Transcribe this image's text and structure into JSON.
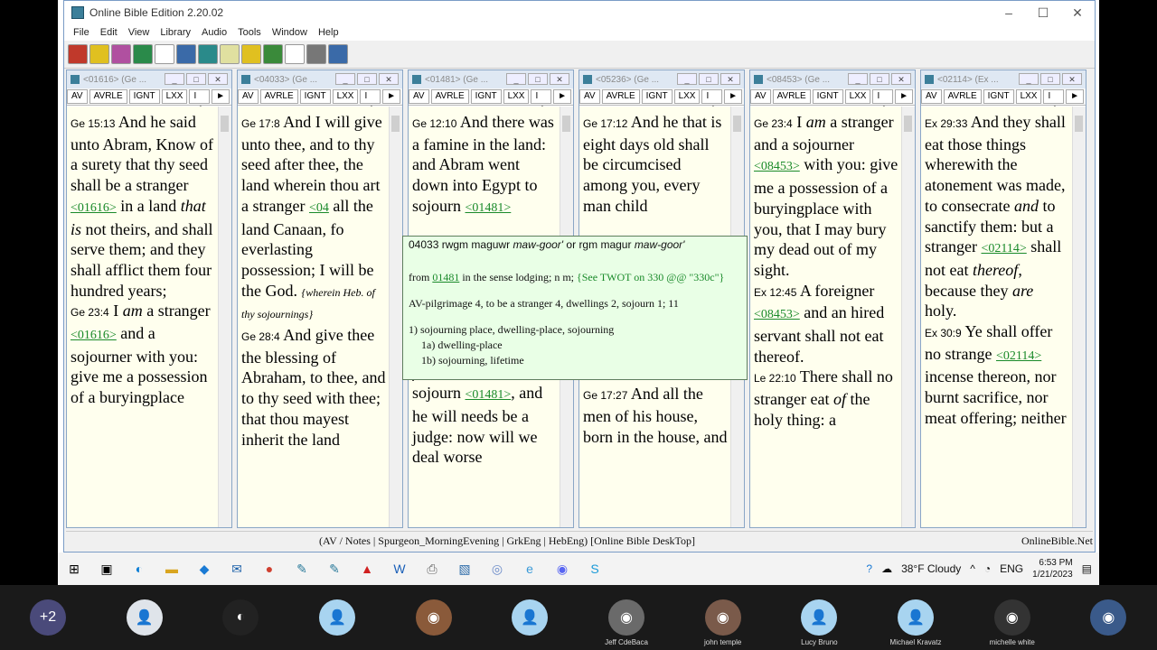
{
  "window": {
    "title": "Online Bible Edition 2.20.02",
    "min": "–",
    "max": "☐",
    "close": "✕"
  },
  "menu": [
    "File",
    "Edit",
    "View",
    "Library",
    "Audio",
    "Tools",
    "Window",
    "Help"
  ],
  "toolbar_icons": [
    "book-red-icon",
    "book-yellow-icon",
    "books-icon",
    "globe-icon",
    "open-book-icon",
    "tools-icon",
    "edit-icon",
    "notes-icon",
    "folder-icon",
    "check-icon",
    "document-icon",
    "printer-icon",
    "search-icon"
  ],
  "pane_tabs": [
    "AV",
    "AVRLE",
    "IGNT",
    "LXX",
    "I ◄",
    "►"
  ],
  "panes": [
    {
      "title": "<01616> (Ge ...",
      "html": "<span class='ref'>Ge 15:13</span> And he said unto Abram, Know of a surety that thy seed shall be a stranger <span class='strong'>&lt;01616&gt;</span> in a land <i>that is</i> not theirs, and shall serve them; and they shall afflict them four hundred years;<br><span class='ref'>Ge 23:4</span> I <i>am</i> a stranger <span class='strong'>&lt;01616&gt;</span> and a sojourner with you: give me a possession of a buryingplace"
    },
    {
      "title": "<04033> (Ge ...",
      "html": "<span class='ref'>Ge 17:8</span> And I will give unto thee, and to thy seed after thee, the land wherein thou art a stranger <span class='strong'>&lt;04</span> all the land Canaan, fo everlasting possession; I will be the God. <span class='note'>{wherein Heb. of thy sojournings}</span><br><span class='ref'>Ge 28:4</span> And give thee the blessing of Abraham, to thee, and to thy seed with thee; that thou mayest inherit the land"
    },
    {
      "title": "<01481> (Ge ...",
      "html": "<span class='ref'>Ge 12:10</span> And there was a famine in the land: and Abram went down into Egypt to sojourn <span class='strong'>&lt;01481&gt;</span><br><br><br><br><br><br><br>said <i>again</i>, This one <i>fellow</i> came in to sojourn <span class='strong'>&lt;01481&gt;</span>, and he will needs be a judge: now will we deal worse"
    },
    {
      "title": "<05236> (Ge ...",
      "html": "<span class='ref'>Ge 17:12</span> And he that is eight days old shall be circumcised among you, every man child<br><br><br><br><br><br>which <i>is</i> not of thy seed. <span class='note'>{he that is eight...: Heb. a son of eight days}</span><br><span class='ref'>Ge 17:27</span> And all the men of his house, born in the house, and"
    },
    {
      "title": "<08453> (Ge ...",
      "html": "<span class='ref'>Ge 23:4</span> I <i>am</i> a stranger and a sojourner <span class='strong'>&lt;08453&gt;</span> with you: give me a possession of a buryingplace with you, that I may bury my dead out of my sight.<br><span class='ref'>Ex 12:45</span> A foreigner <span class='strong'>&lt;08453&gt;</span> and an hired servant shall not eat thereof.<br><span class='ref'>Le 22:10</span> There shall no stranger eat <i>of</i> the holy thing: a"
    },
    {
      "title": "<02114> (Ex ...",
      "html": "<span class='ref'>Ex 29:33</span> And they shall eat those things wherewith the atonement was made, to consecrate <i>and</i> to sanctify them: but a stranger <span class='strong'>&lt;02114&gt;</span> shall not eat <i>thereof</i>, because they <i>are</i> holy.<br><span class='ref'>Ex 30:9</span> Ye shall offer no strange <span class='strong'>&lt;02114&gt;</span> incense thereon, nor burnt sacrifice, nor meat offering; neither"
    }
  ],
  "popup": {
    "line1_num": "04033",
    "line1_translit": "rwgm",
    "line1_word": "maguwr",
    "line1_pron": "maw-goor'",
    "line1_or": "or",
    "line1_alt": "rgm",
    "line1_alt_word": "magur",
    "line1_alt_pron": "maw-goor'",
    "line2_from": "from",
    "line2_link": "01481",
    "line2_rest": "in the sense lodging; n m;",
    "line2_twot": "{See TWOT on 330 @@ \"330c\"}",
    "line3": "AV-pilgrimage 4, to be a stranger 4, dwellings 2, sojourn 1; 11",
    "def1": "1) sojourning place, dwelling-place, sojourning",
    "def1a": "1a) dwelling-place",
    "def1b": "1b) sojourning, lifetime"
  },
  "statusbar": {
    "mid": "(AV / Notes | Spurgeon_MorningEvening | GrkEng | HebEng)   [Online Bible DeskTop]",
    "right": "OnlineBible.Net"
  },
  "taskbar": {
    "weather": "38°F  Cloudy",
    "lang": "ENG",
    "time": "6:53 PM",
    "date": "1/21/2023"
  },
  "participants": [
    {
      "name": "",
      "initials": "+2",
      "color": "#4a4a7a"
    },
    {
      "name": "",
      "initials": "👤",
      "color": "#dfe4ea"
    },
    {
      "name": "",
      "initials": "◐",
      "color": "#222"
    },
    {
      "name": "",
      "initials": "👤",
      "color": "#a8d4f0"
    },
    {
      "name": "",
      "initials": "◉",
      "color": "#8a5a3a"
    },
    {
      "name": "",
      "initials": "👤",
      "color": "#a8d4f0"
    },
    {
      "name": "Jeff CdeBaca",
      "initials": "◉",
      "color": "#6a6a6a"
    },
    {
      "name": "john temple",
      "initials": "◉",
      "color": "#7a5a4a"
    },
    {
      "name": "Lucy Bruno",
      "initials": "👤",
      "color": "#a8d4f0"
    },
    {
      "name": "Michael Kravatz",
      "initials": "👤",
      "color": "#a8d4f0"
    },
    {
      "name": "michelle white",
      "initials": "◉",
      "color": "#333"
    },
    {
      "name": "",
      "initials": "◉",
      "color": "#3a5a8a"
    }
  ]
}
